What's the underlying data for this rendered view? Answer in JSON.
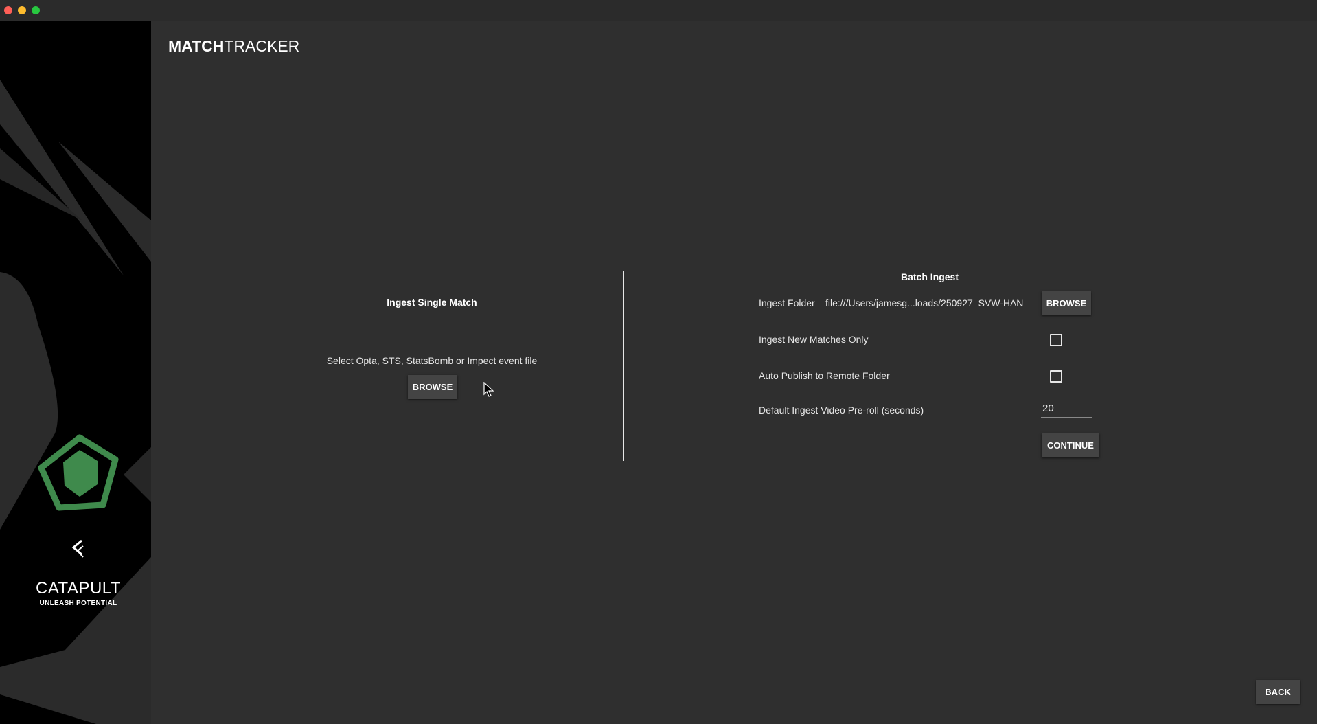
{
  "app": {
    "title_bold": "MATCH",
    "title_rest": "TRACKER"
  },
  "brand": {
    "name": "CATAPULT",
    "tagline": "UNLEASH POTENTIAL",
    "accent_color": "#3f8a4c"
  },
  "single": {
    "title": "Ingest Single Match",
    "instruction": "Select Opta, STS, StatsBomb or Impect event file",
    "browse_label": "BROWSE"
  },
  "batch": {
    "title": "Batch Ingest",
    "folder_label": "Ingest Folder",
    "folder_path": "file:///Users/jamesg...loads/250927_SVW-HAN",
    "browse_label": "BROWSE",
    "new_only_label": "Ingest New Matches Only",
    "new_only_checked": false,
    "auto_publish_label": "Auto Publish to Remote Folder",
    "auto_publish_checked": false,
    "preroll_label": "Default Ingest Video Pre-roll (seconds)",
    "preroll_value": "20",
    "continue_label": "CONTINUE"
  },
  "footer": {
    "back_label": "BACK"
  }
}
